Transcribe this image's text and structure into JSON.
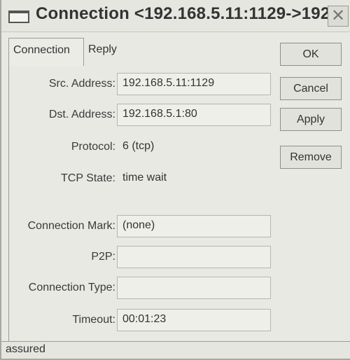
{
  "window": {
    "title": "Connection <192.168.5.11:1129->192..."
  },
  "tabs": [
    {
      "label": "Connection",
      "active": true
    },
    {
      "label": "Reply",
      "active": false
    }
  ],
  "form": {
    "src_address": {
      "label": "Src. Address:",
      "value": "192.168.5.11:1129"
    },
    "dst_address": {
      "label": "Dst. Address:",
      "value": "192.168.5.1:80"
    },
    "protocol": {
      "label": "Protocol:",
      "value": "6 (tcp)"
    },
    "tcp_state": {
      "label": "TCP State:",
      "value": "time wait"
    },
    "connection_mark": {
      "label": "Connection Mark:",
      "value": "(none)"
    },
    "p2p": {
      "label": "P2P:",
      "value": ""
    },
    "connection_type": {
      "label": "Connection Type:",
      "value": ""
    },
    "timeout": {
      "label": "Timeout:",
      "value": "00:01:23"
    }
  },
  "buttons": {
    "ok": "OK",
    "cancel": "Cancel",
    "apply": "Apply",
    "remove": "Remove"
  },
  "status": {
    "text": "assured"
  },
  "icons": {
    "window": "window-icon",
    "close": "close-icon"
  }
}
